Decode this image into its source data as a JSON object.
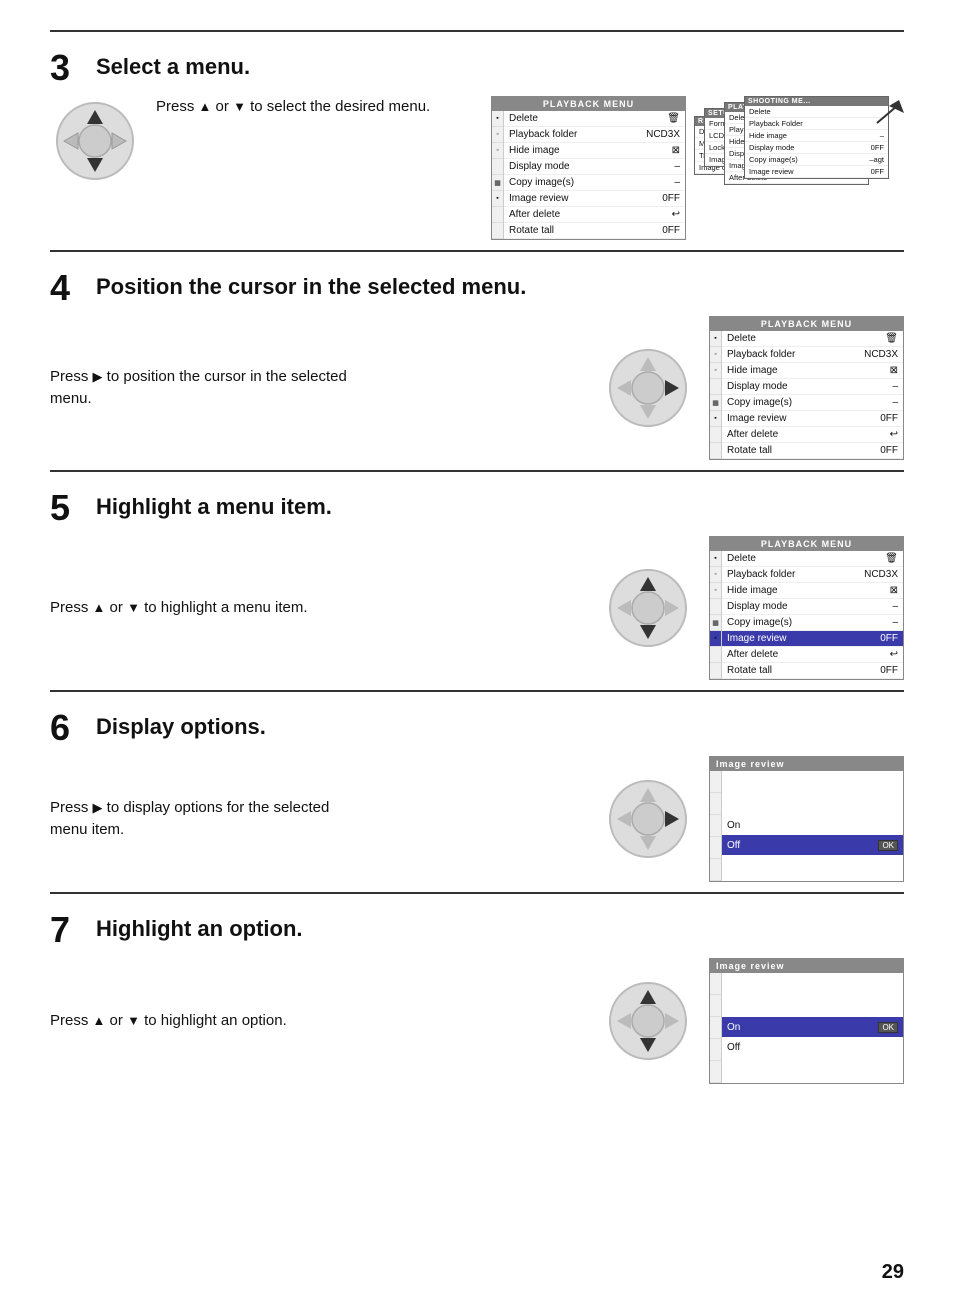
{
  "page": {
    "number": "29"
  },
  "steps": {
    "step3": {
      "number": "3",
      "title": "Select a menu.",
      "text": "Press ",
      "text2": " or ",
      "text3": " to select the desired menu.",
      "menu": {
        "header": "PLAYBACK MENU",
        "rows": [
          {
            "label": "Delete",
            "value": ""
          },
          {
            "label": "Playback folder",
            "value": "NCD3X"
          },
          {
            "label": "Hide image",
            "value": ""
          },
          {
            "label": "Display mode",
            "value": "–"
          },
          {
            "label": "Copy image(s)",
            "value": "–"
          },
          {
            "label": "Image review",
            "value": "0FF"
          },
          {
            "label": "After delete",
            "value": ""
          },
          {
            "label": "Rotate tall",
            "value": "0FF"
          }
        ]
      }
    },
    "step4": {
      "number": "4",
      "title": "Position the cursor in the selected menu.",
      "text": "Press ",
      "text2": " to position the cursor in the selected menu.",
      "menu": {
        "header": "PLAYBACK MENU",
        "rows": [
          {
            "label": "Delete",
            "value": "",
            "highlight": false,
            "bold": false
          },
          {
            "label": "Playback folder",
            "value": "NCD3X",
            "highlight": false
          },
          {
            "label": "Hide image",
            "value": "",
            "highlight": false
          },
          {
            "label": "Display mode",
            "value": "–",
            "highlight": false
          },
          {
            "label": "Copy image(s)",
            "value": "–",
            "highlight": false
          },
          {
            "label": "Image review",
            "value": "0FF",
            "highlight": false
          },
          {
            "label": "After delete",
            "value": "",
            "highlight": false
          },
          {
            "label": "Rotate tall",
            "value": "0FF",
            "highlight": false
          }
        ]
      }
    },
    "step5": {
      "number": "5",
      "title": "Highlight a menu item.",
      "text": "Press ",
      "text2": " or ",
      "text3": " to highlight a menu item.",
      "menu": {
        "header": "PLAYBACK MENU",
        "rows": [
          {
            "label": "Delete",
            "value": "",
            "highlight": false
          },
          {
            "label": "Playback folder",
            "value": "NCD3X",
            "highlight": false
          },
          {
            "label": "Hide image",
            "value": "",
            "highlight": false
          },
          {
            "label": "Display mode",
            "value": "–",
            "highlight": false
          },
          {
            "label": "Copy image(s)",
            "value": "–",
            "highlight": false
          },
          {
            "label": "Image review",
            "value": "0FF",
            "highlight": true
          },
          {
            "label": "After delete",
            "value": "",
            "highlight": false
          },
          {
            "label": "Rotate tall",
            "value": "0FF",
            "highlight": false
          }
        ]
      }
    },
    "step6": {
      "number": "6",
      "title": "Display options.",
      "text": "Press ",
      "text2": " to display options for the selected menu item.",
      "menu": {
        "header": "Image review",
        "rows": [
          {
            "label": "",
            "value": "",
            "blank": true
          },
          {
            "label": "",
            "value": "",
            "blank": true
          },
          {
            "label": "On",
            "value": "",
            "highlight": false
          },
          {
            "label": "Off",
            "value": "OK",
            "highlight": true
          }
        ]
      }
    },
    "step7": {
      "number": "7",
      "title": "Highlight an option.",
      "text": "Press ",
      "text2": " or ",
      "text3": " to highlight an option.",
      "menu": {
        "header": "Image review",
        "rows": [
          {
            "label": "",
            "value": "",
            "blank": true
          },
          {
            "label": "",
            "value": "",
            "blank": true
          },
          {
            "label": "On",
            "value": "OK",
            "highlight": true
          },
          {
            "label": "Off",
            "value": "",
            "highlight": false
          }
        ]
      }
    }
  }
}
